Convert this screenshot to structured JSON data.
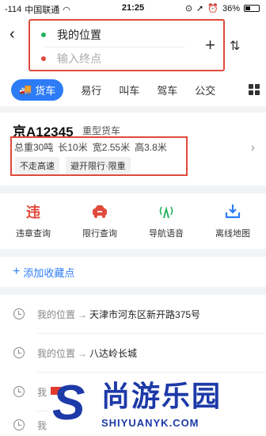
{
  "status_bar": {
    "signal": "-114",
    "carrier": "中国联通",
    "time": "21:25",
    "battery": "36%",
    "battery_level": 0.36
  },
  "route": {
    "from": "我的位置",
    "to_placeholder": "输入终点"
  },
  "tabs": {
    "active": "货车",
    "items": [
      "易行",
      "叫车",
      "驾车",
      "公交"
    ]
  },
  "truck": {
    "plate": "京A12345",
    "type": "重型货车",
    "specs": [
      "总重30吨",
      "长10米",
      "宽2.55米",
      "高3.8米"
    ],
    "tags": [
      "不走高速",
      "避开限行·限重"
    ]
  },
  "tools": [
    {
      "label": "违章查询",
      "icon": "violation-icon",
      "glyph": "违",
      "color": "#e04a3c"
    },
    {
      "label": "限行查询",
      "icon": "restriction-car-icon",
      "glyph": "🚗",
      "color": "#e04a3c"
    },
    {
      "label": "导航语音",
      "icon": "voice-signal-icon",
      "glyph": "▲",
      "color": "#22b35e"
    },
    {
      "label": "离线地图",
      "icon": "download-icon",
      "glyph": "⬇",
      "color": "#2d7cf6"
    }
  ],
  "favorites": {
    "add_label": "添加收藏点"
  },
  "history": [
    {
      "from": "我的位置",
      "dest": "天津市河东区新开路375号"
    },
    {
      "from": "我的位置",
      "dest": "八达岭长城"
    },
    {
      "from": "我",
      "dest": ""
    },
    {
      "from": "我",
      "dest": ""
    }
  ],
  "watermark": {
    "letter": "S",
    "cn": "尚游乐园",
    "en": "SHIYUANYK.COM"
  },
  "colors": {
    "accent": "#2d7cf6",
    "highlight_border": "#e04a3c",
    "green": "#22b35e",
    "watermark_blue": "#1d3aa8"
  }
}
